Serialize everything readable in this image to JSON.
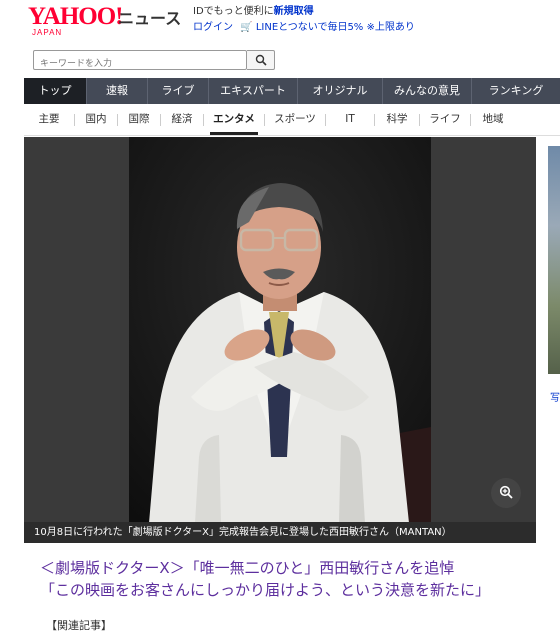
{
  "header": {
    "logo_main": "YAHOO!",
    "logo_sub": "JAPAN",
    "logo_news": "ニュース",
    "id_text": "IDでもっと便利に",
    "register_link": "新規取得",
    "login_link": "ログイン",
    "line_promo": "LINEとつないで毎日5% ※上限あり"
  },
  "search": {
    "placeholder": "キーワードを入力"
  },
  "nav_main": [
    {
      "label": "トップ",
      "active": true
    },
    {
      "label": "速報"
    },
    {
      "label": "ライブ"
    },
    {
      "label": "エキスパート"
    },
    {
      "label": "オリジナル"
    },
    {
      "label": "みんなの意見"
    },
    {
      "label": "ランキング"
    }
  ],
  "nav_sub": [
    {
      "label": "主要"
    },
    {
      "label": "国内"
    },
    {
      "label": "国際"
    },
    {
      "label": "経済"
    },
    {
      "label": "エンタメ",
      "active": true
    },
    {
      "label": "スポーツ"
    },
    {
      "label": "IT"
    },
    {
      "label": "科学"
    },
    {
      "label": "ライフ"
    },
    {
      "label": "地域"
    }
  ],
  "article": {
    "photo_caption": "10月8日に行われた「劇場版ドクターX」完成報告会見に登場した西田敏行さん（MANTAN）",
    "headline_line1": "＜劇場版ドクターX＞「唯一無二のひと」西田敏行さんを追悼",
    "headline_line2": "「この映画をお客さんにしっかり届けよう、という決意を新たに」",
    "related_label": "【関連記事】"
  },
  "sidebar": {
    "partial_text": "写"
  },
  "icons": {
    "search": "search-icon",
    "zoom": "zoom-in-icon",
    "cart": "cart-icon"
  },
  "colors": {
    "brand_red": "#ff0033",
    "nav_bg": "#444a57",
    "nav_active": "#1d2025",
    "headline": "#5d2f9e",
    "link": "#0033cc"
  }
}
